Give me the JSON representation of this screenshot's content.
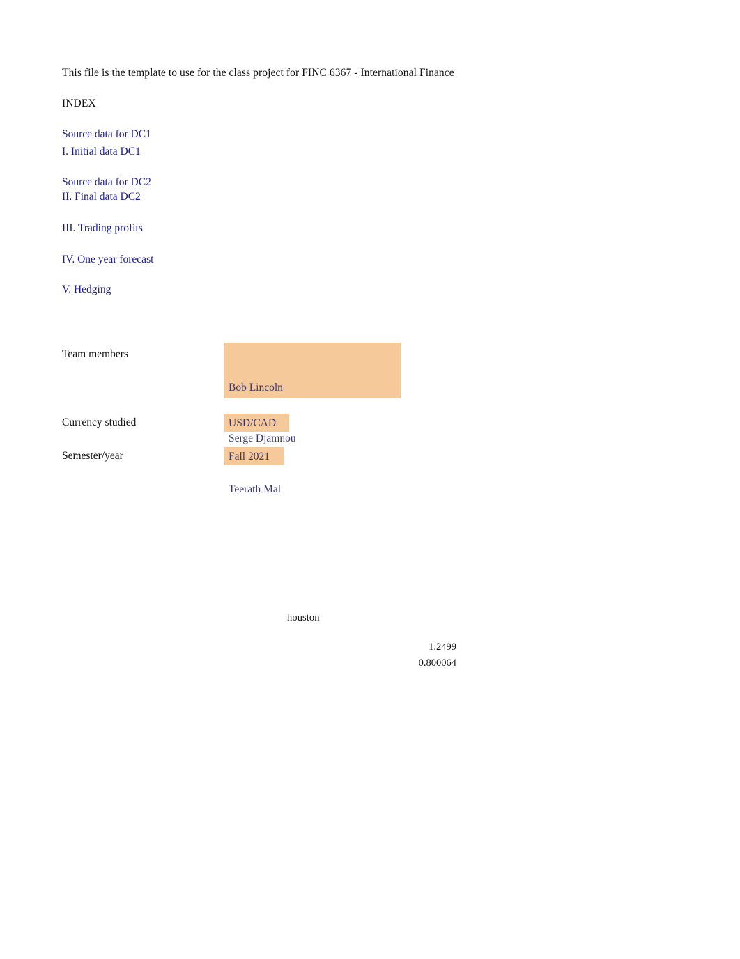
{
  "document": {
    "title_line": "This file is the template to use for the class project for FINC 6367 - International Finance",
    "index_heading": "INDEX"
  },
  "index": {
    "items": [
      {
        "label": "Source data for DC1"
      },
      {
        "label": "I. Initial data DC1"
      },
      {
        "label": "Source data for DC2"
      },
      {
        "label": "II. Final data DC2"
      },
      {
        "label": "III. Trading profits"
      },
      {
        "label": "IV. One year forecast"
      },
      {
        "label": "V. Hedging"
      }
    ]
  },
  "form": {
    "team_members_label": "Team members",
    "team_members": [
      "Bob Lincoln",
      "Serge Djamnou",
      "Teerath Mal"
    ],
    "currency_label": "Currency studied",
    "currency_value": "USD/CAD",
    "semester_label": "Semester/year",
    "semester_value": "Fall 2021"
  },
  "scratch": {
    "city": "houston",
    "value_1": "1.2499",
    "value_2": "0.800064"
  },
  "colors": {
    "page_background": "#ffffff",
    "body_text": "#111111",
    "hyperlink": "#1d1d8f",
    "highlight_fill": "#f6c99a",
    "highlight_text": "#3b3b6d"
  }
}
